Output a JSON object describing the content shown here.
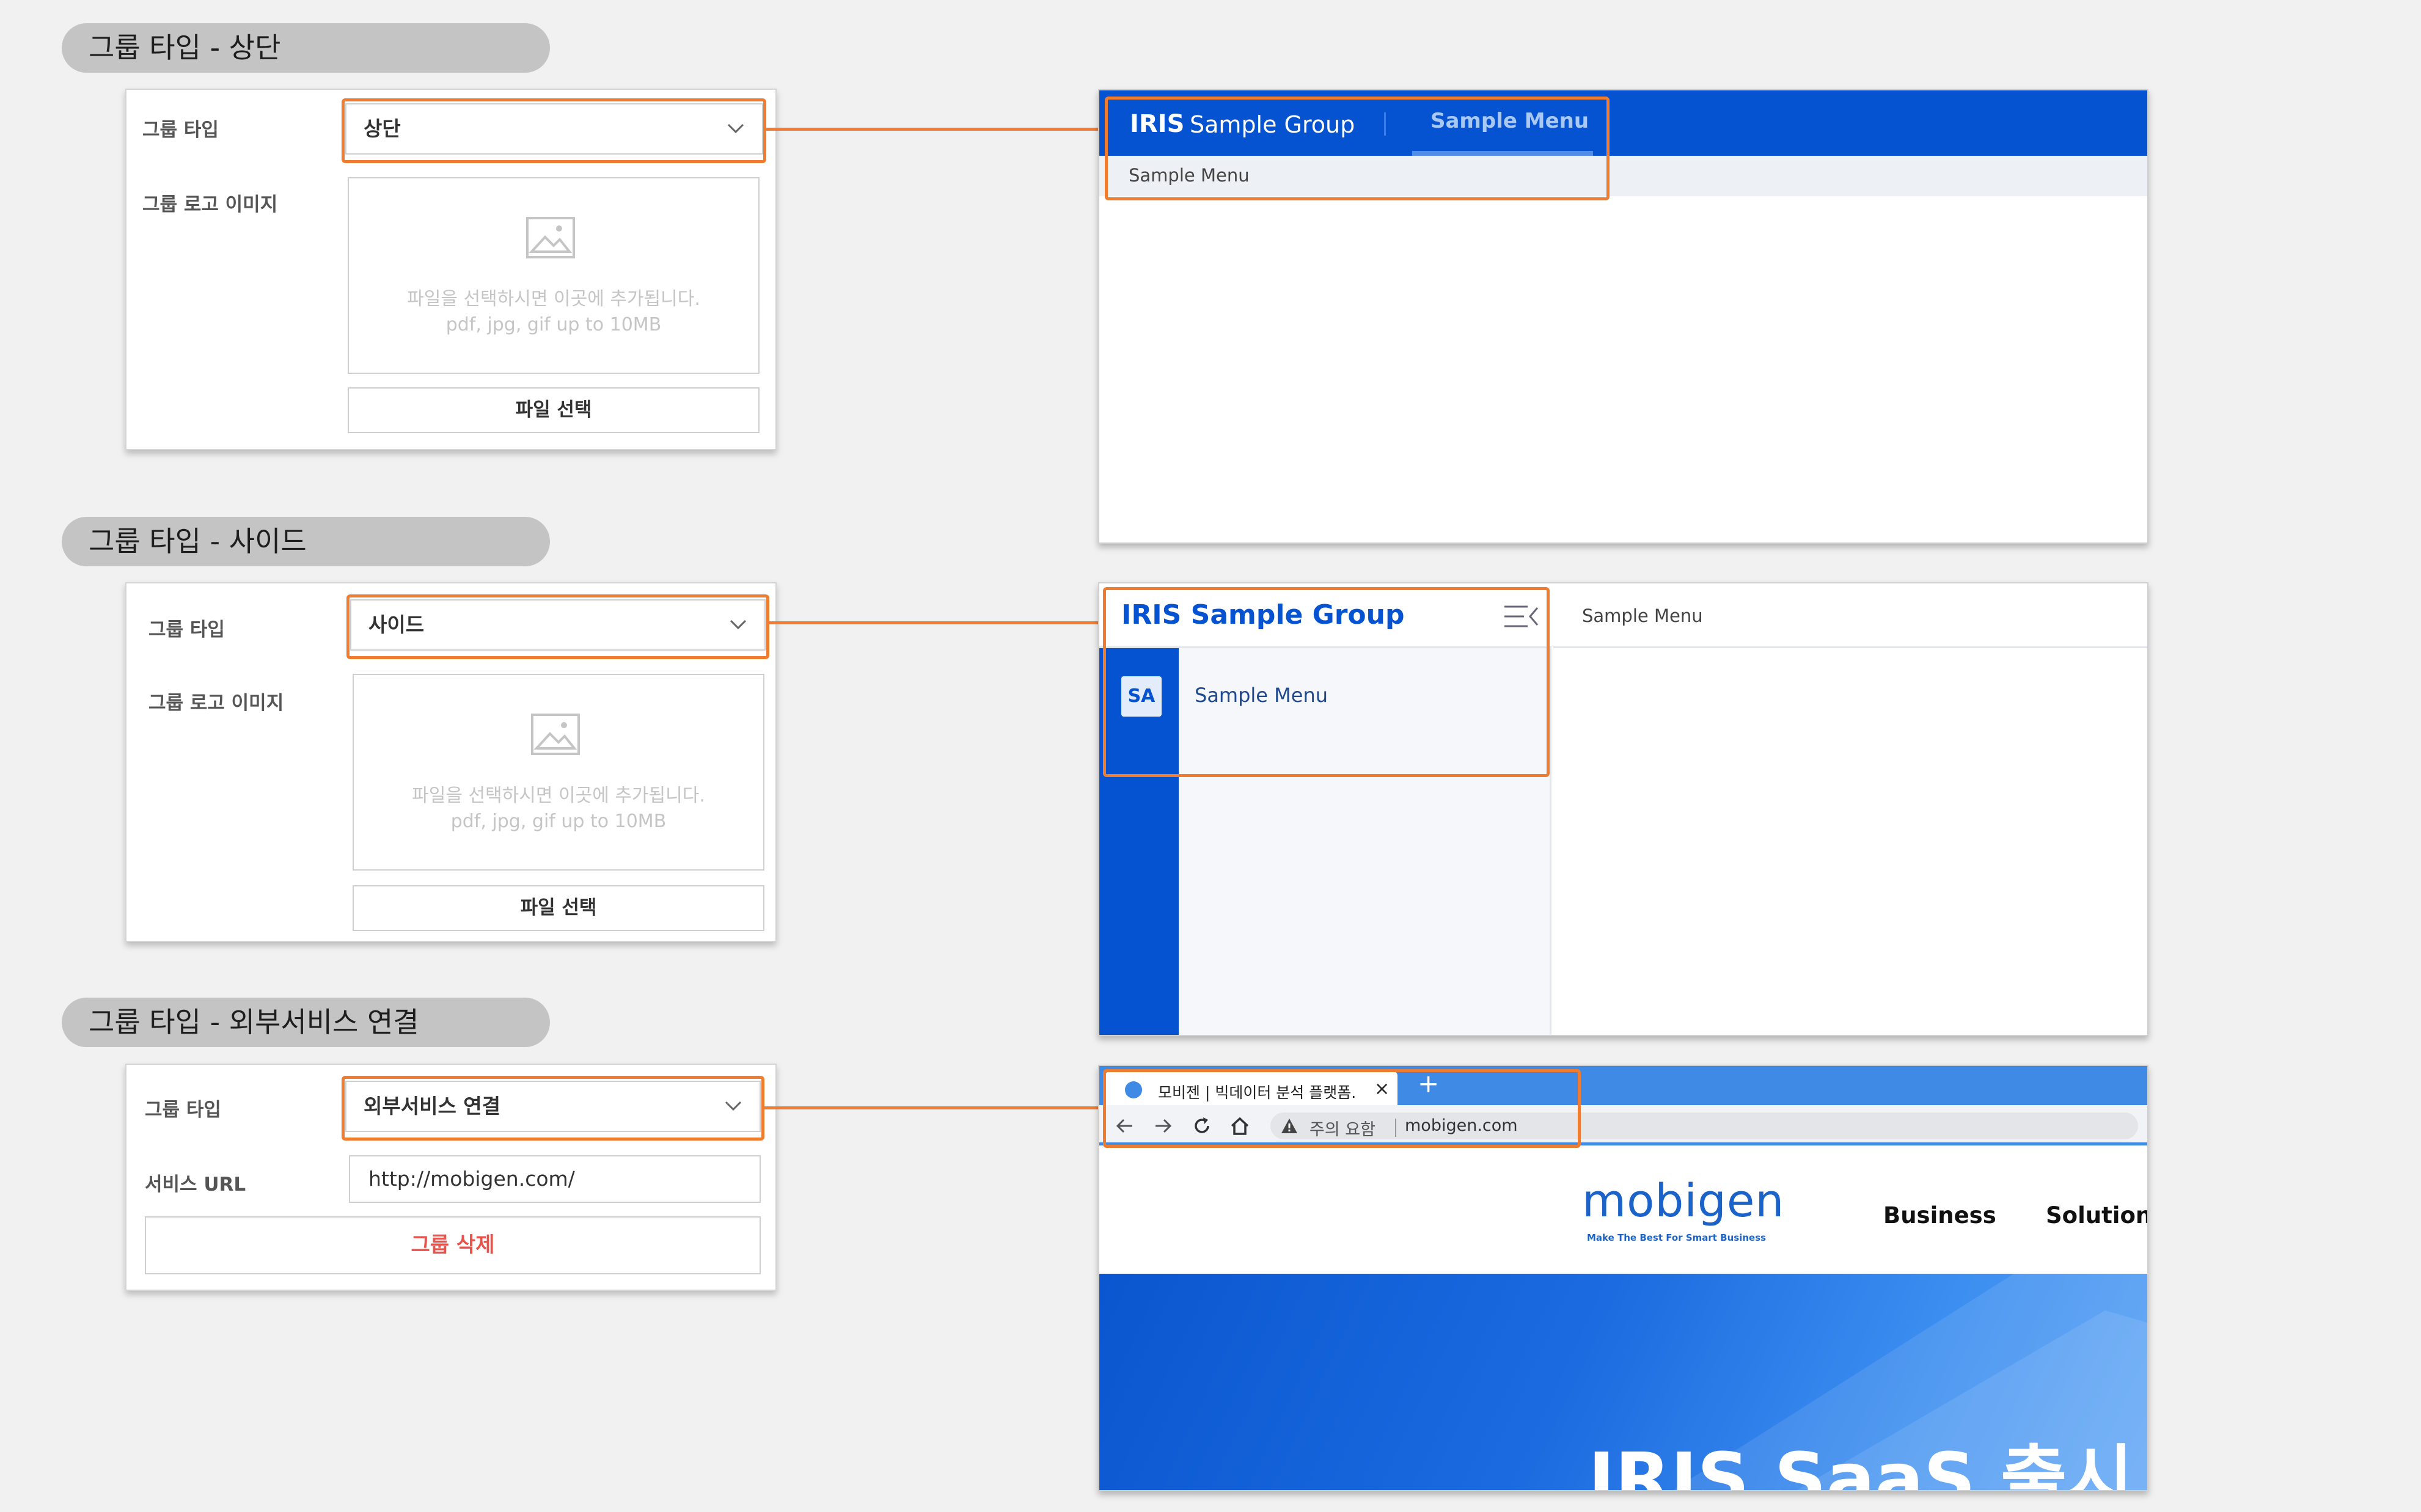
{
  "sections": {
    "top": {
      "title": "그룹 타입 - 상단"
    },
    "side": {
      "title": "그룹 타입 - 사이드"
    },
    "ext": {
      "title": "그룹 타입 - 외부서비스 연결"
    }
  },
  "cards": {
    "top": {
      "group_type_label": "그룹 타입",
      "group_type_value": "상단",
      "logo_label": "그룹 로고 이미지",
      "drop_hint": "파일을 선택하시면 이곳에 추가됩니다.",
      "drop_formats": "pdf, jpg, gif up to 10MB",
      "file_button": "파일 선택"
    },
    "side": {
      "group_type_label": "그룹 타입",
      "group_type_value": "사이드",
      "logo_label": "그룹 로고 이미지",
      "drop_hint": "파일을 선택하시면 이곳에 추가됩니다.",
      "drop_formats": "pdf, jpg, gif up to 10MB",
      "file_button": "파일 선택"
    },
    "ext": {
      "group_type_label": "그룹 타입",
      "group_type_value": "외부서비스 연결",
      "url_label": "서비스 URL",
      "url_value": "http://mobigen.com/",
      "delete_button": "그룹 삭제"
    }
  },
  "previews": {
    "top": {
      "brand_iris": "IRIS",
      "brand_group": "Sample Group",
      "menu": "Sample Menu",
      "submenu": "Sample Menu"
    },
    "side": {
      "brand": "IRIS  Sample Group",
      "badge": "SA",
      "menu_item": "Sample Menu",
      "top_text": "Sample Menu"
    },
    "ext": {
      "tab_title": "모비젠 | 빅데이터 분석 플랫폼.",
      "tab_close": "×",
      "tab_new": "+",
      "security_label": "주의 요함",
      "address": "mobigen.com",
      "logo": "mobigen",
      "logo_tagline": "Make The Best For Smart Business",
      "nav": [
        "Business",
        "Solutions"
      ],
      "hero_title": "IRIS SaaS 출시"
    }
  },
  "colors": {
    "highlight": "#ef7d31",
    "brand_blue": "#0553d0",
    "delete_red": "#e8524a"
  }
}
